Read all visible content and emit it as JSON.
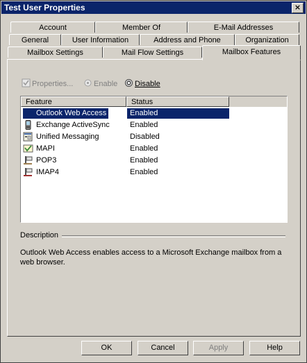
{
  "window": {
    "title": "Test User Properties"
  },
  "tabs": {
    "row1": [
      "Account",
      "Member Of",
      "E-Mail Addresses"
    ],
    "row2": [
      "General",
      "User Information",
      "Address and Phone",
      "Organization"
    ],
    "row3": [
      "Mailbox Settings",
      "Mail Flow Settings",
      "Mailbox Features"
    ]
  },
  "toolbar": {
    "properties": "Properties...",
    "enable": "Enable",
    "disable": "Disable"
  },
  "list": {
    "columns": [
      "Feature",
      "Status"
    ],
    "rows": [
      {
        "feature": "Outlook Web Access",
        "status": "Enabled",
        "icon": "owa-icon"
      },
      {
        "feature": "Exchange ActiveSync",
        "status": "Enabled",
        "icon": "mobile-device-icon"
      },
      {
        "feature": "Unified Messaging",
        "status": "Disabled",
        "icon": "unified-messaging-icon"
      },
      {
        "feature": "MAPI",
        "status": "Enabled",
        "icon": "mapi-icon"
      },
      {
        "feature": "POP3",
        "status": "Enabled",
        "icon": "pop3-icon"
      },
      {
        "feature": "IMAP4",
        "status": "Enabled",
        "icon": "imap4-icon"
      }
    ]
  },
  "description": {
    "label": "Description",
    "text": "Outlook Web Access enables access to a Microsoft Exchange mailbox from a web browser."
  },
  "buttons": {
    "ok": "OK",
    "cancel": "Cancel",
    "apply": "Apply",
    "help": "Help"
  }
}
